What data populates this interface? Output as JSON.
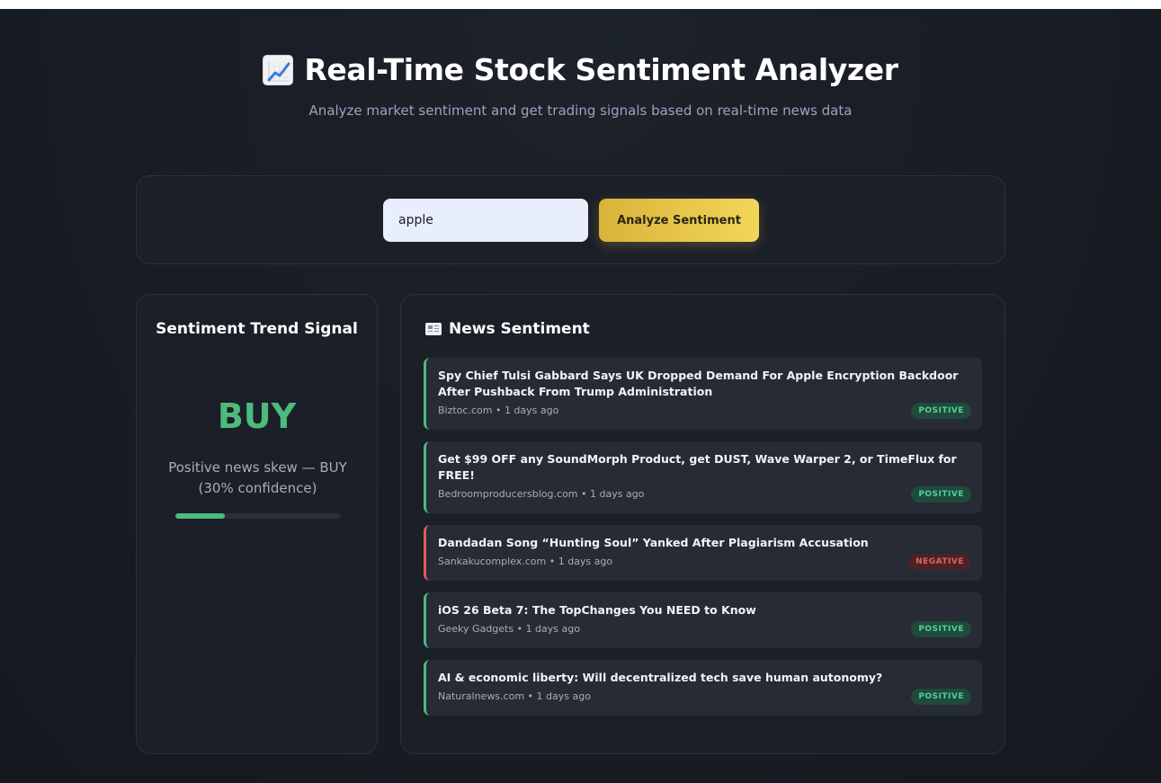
{
  "header": {
    "title": "Real-Time Stock Sentiment Analyzer",
    "title_icon": "chart-increasing-emoji",
    "subtitle": "Analyze market sentiment and get trading signals based on real-time news data"
  },
  "search": {
    "value": "apple",
    "button_label": "Analyze Sentiment"
  },
  "signal": {
    "title": "Sentiment Trend Signal",
    "value": "BUY",
    "description": "Positive news skew — BUY (30% confidence)",
    "confidence": 0.3,
    "color": "#4cbb7b"
  },
  "news": {
    "title": "News Sentiment",
    "icon": "newspaper-emoji",
    "items": [
      {
        "headline": "Spy Chief Tulsi Gabbard Says UK Dropped Demand For Apple Encryption Backdoor After Pushback From Trump Administration",
        "meta": "Biztoc.com • 1 days ago",
        "sentiment": "POSITIVE"
      },
      {
        "headline": "Get $99 OFF any SoundMorph Product, get DUST, Wave Warper 2, or TimeFlux for FREE!",
        "meta": "Bedroomproducersblog.com • 1 days ago",
        "sentiment": "POSITIVE"
      },
      {
        "headline": "Dandadan Song “Hunting Soul” Yanked After Plagiarism Accusation",
        "meta": "Sankakucomplex.com • 1 days ago",
        "sentiment": "NEGATIVE"
      },
      {
        "headline": "iOS 26 Beta 7: The TopChanges You NEED to Know",
        "meta": "Geeky Gadgets • 1 days ago",
        "sentiment": "POSITIVE"
      },
      {
        "headline": "AI & economic liberty: Will decentralized tech save human autonomy?",
        "meta": "Naturalnews.com • 1 days ago",
        "sentiment": "POSITIVE"
      }
    ]
  },
  "colors": {
    "positive": "#4fd39a",
    "negative": "#e56060",
    "accent": "#f2d65a",
    "background": "#171b22"
  }
}
